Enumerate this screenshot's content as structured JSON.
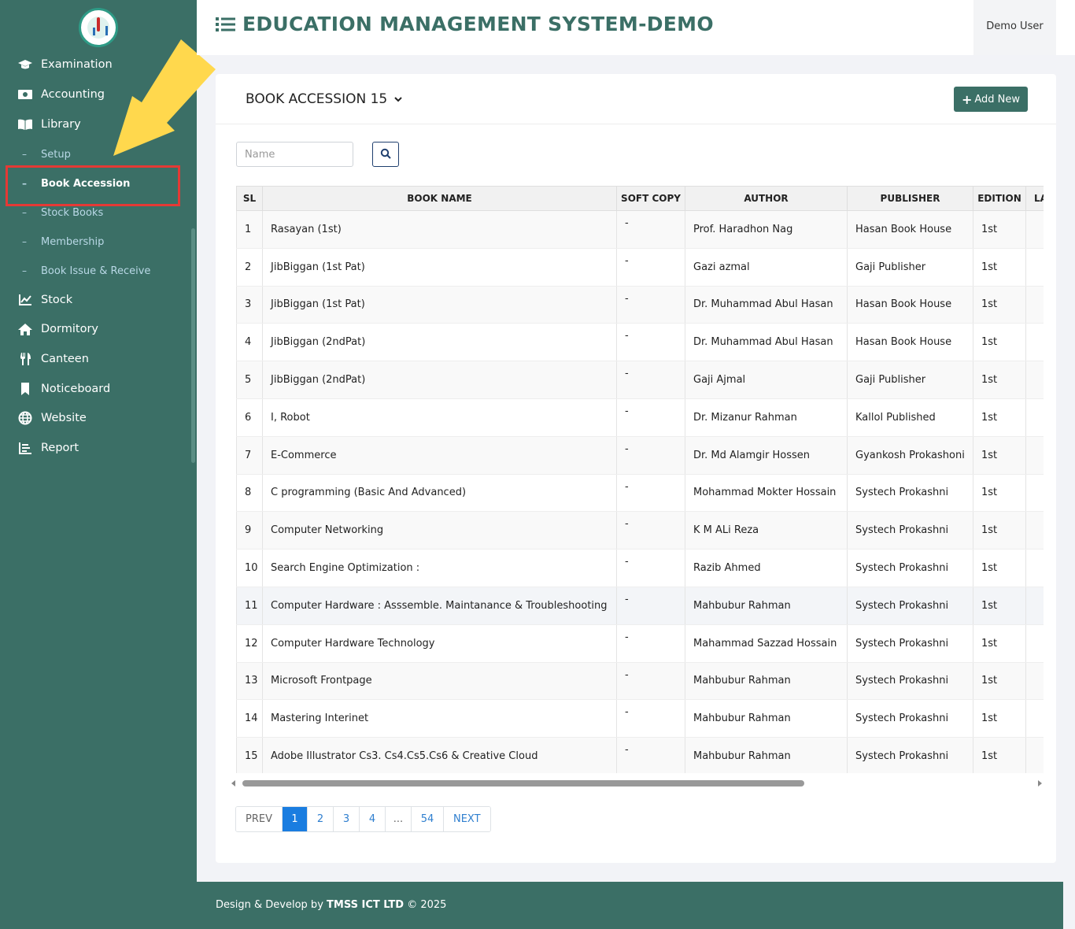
{
  "app": {
    "title": "EDUCATION MANAGEMENT SYSTEM-DEMO",
    "user": "Demo User"
  },
  "sidebar": {
    "items": [
      {
        "label": "Examination",
        "icon": "graduation-cap-icon"
      },
      {
        "label": "Accounting",
        "icon": "money-icon"
      },
      {
        "label": "Library",
        "icon": "book-icon"
      },
      {
        "label": "Stock",
        "icon": "line-chart-icon"
      },
      {
        "label": "Dormitory",
        "icon": "home-icon"
      },
      {
        "label": "Canteen",
        "icon": "utensils-icon"
      },
      {
        "label": "Noticeboard",
        "icon": "bookmark-icon"
      },
      {
        "label": "Website",
        "icon": "globe-icon"
      },
      {
        "label": "Report",
        "icon": "report-icon"
      }
    ],
    "library_sub": [
      {
        "label": "Setup"
      },
      {
        "label": "Book Accession",
        "active": true
      },
      {
        "label": "Stock Books"
      },
      {
        "label": "Membership"
      },
      {
        "label": "Book Issue & Receive"
      }
    ]
  },
  "page": {
    "title": "BOOK ACCESSION 15",
    "add_label": "Add New",
    "search_placeholder": "Name"
  },
  "table": {
    "headers": [
      "SL",
      "BOOK NAME",
      "SOFT COPY",
      "AUTHOR",
      "PUBLISHER",
      "EDITION",
      "LA"
    ],
    "rows": [
      [
        "1",
        "Rasayan (1st)",
        "-",
        "Prof. Haradhon Nag",
        "Hasan Book House",
        "1st"
      ],
      [
        "2",
        "JibBiggan (1st Pat)",
        "-",
        "Gazi azmal",
        "Gaji Publisher",
        "1st"
      ],
      [
        "3",
        "JibBiggan (1st Pat)",
        "-",
        "Dr. Muhammad Abul Hasan",
        "Hasan Book House",
        "1st"
      ],
      [
        "4",
        "JibBiggan (2ndPat)",
        "-",
        "Dr. Muhammad Abul Hasan",
        "Hasan Book House",
        "1st"
      ],
      [
        "5",
        "JibBiggan (2ndPat)",
        "-",
        "Gaji Ajmal",
        "Gaji Publisher",
        "1st"
      ],
      [
        "6",
        "I, Robot",
        "-",
        "Dr. Mizanur Rahman",
        "Kallol Published",
        "1st"
      ],
      [
        "7",
        "E-Commerce",
        "-",
        "Dr. Md Alamgir Hossen",
        "Gyankosh Prokashoni",
        "1st"
      ],
      [
        "8",
        "C programming (Basic And Advanced)",
        "-",
        "Mohammad Mokter Hossain",
        "Systech Prokashni",
        "1st"
      ],
      [
        "9",
        "Computer Networking",
        "-",
        "K M ALi Reza",
        "Systech Prokashni",
        "1st"
      ],
      [
        "10",
        "Search Engine Optimization :",
        "-",
        "Razib Ahmed",
        "Systech Prokashni",
        "1st"
      ],
      [
        "11",
        "Computer Hardware : Asssemble. Maintanance & Troubleshooting",
        "-",
        "Mahbubur Rahman",
        "Systech Prokashni",
        "1st"
      ],
      [
        "12",
        "Computer Hardware Technology",
        "-",
        "Mahammad Sazzad Hossain",
        "Systech Prokashni",
        "1st"
      ],
      [
        "13",
        "Microsoft Frontpage",
        "-",
        "Mahbubur Rahman",
        "Systech Prokashni",
        "1st"
      ],
      [
        "14",
        "Mastering Interinet",
        "-",
        "Mahbubur Rahman",
        "Systech Prokashni",
        "1st"
      ],
      [
        "15",
        "Adobe Illustrator Cs3. Cs4.Cs5.Cs6 & Creative Cloud",
        "-",
        "Mahbubur Rahman",
        "Systech Prokashni",
        "1st"
      ]
    ]
  },
  "pagination": [
    "PREV",
    "1",
    "2",
    "3",
    "4",
    "...",
    "54",
    "NEXT"
  ],
  "footer": {
    "prefix": "Design & Develop by",
    "company": "TMSS ICT LTD",
    "suffix": "© 2025"
  },
  "colors": {
    "primary": "#3b6f66",
    "active_page": "#1a7de0",
    "highlight": "#e53935",
    "arrow": "#ffd84d"
  }
}
